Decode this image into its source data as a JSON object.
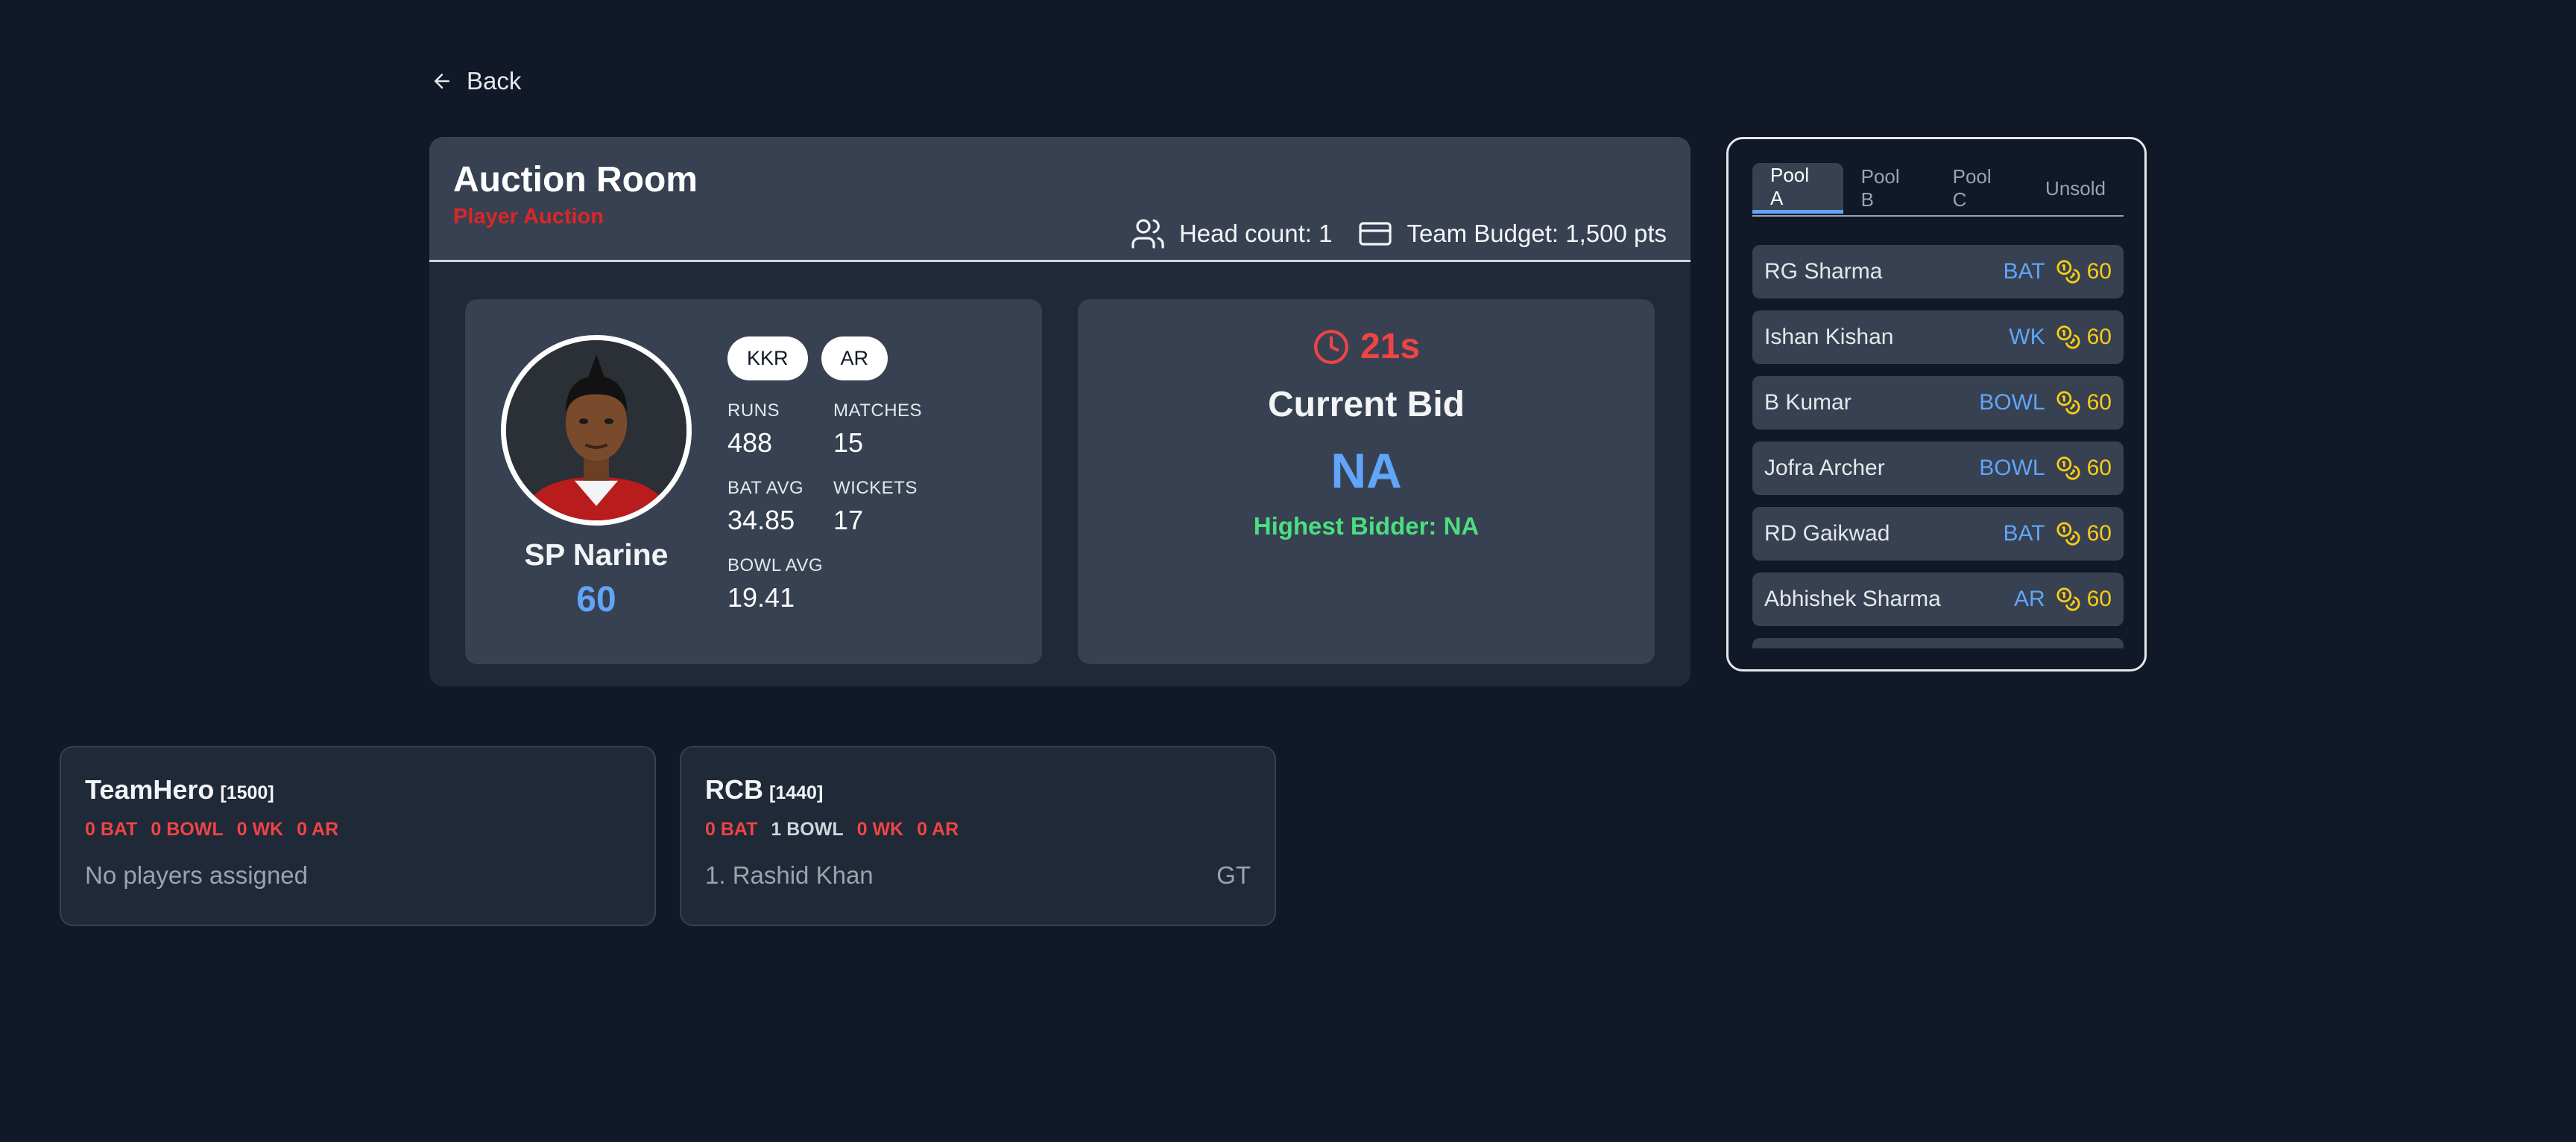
{
  "nav": {
    "back_label": "Back"
  },
  "room": {
    "title": "Auction Room",
    "subtitle": "Player Auction",
    "head_count": "Head count: 1",
    "team_budget": "Team Budget: 1,500 pts"
  },
  "player": {
    "name": "SP Narine",
    "price": "60",
    "badges": [
      "KKR",
      "AR"
    ],
    "stats": [
      {
        "label": "RUNS",
        "value": "488"
      },
      {
        "label": "MATCHES",
        "value": "15"
      },
      {
        "label": "BAT AVG",
        "value": "34.85"
      },
      {
        "label": "WICKETS",
        "value": "17"
      },
      {
        "label": "BOWL AVG",
        "value": "19.41"
      }
    ]
  },
  "bid": {
    "timer": "21s",
    "title": "Current Bid",
    "value": "NA",
    "bidder": "Highest Bidder: NA"
  },
  "pools": {
    "tabs": [
      "Pool A",
      "Pool B",
      "Pool C",
      "Unsold"
    ],
    "active_tab": "Pool A",
    "players": [
      {
        "name": "RG Sharma",
        "role": "BAT",
        "cost": "60"
      },
      {
        "name": "Ishan Kishan",
        "role": "WK",
        "cost": "60"
      },
      {
        "name": "B Kumar",
        "role": "BOWL",
        "cost": "60"
      },
      {
        "name": "Jofra Archer",
        "role": "BOWL",
        "cost": "60"
      },
      {
        "name": "RD Gaikwad",
        "role": "BAT",
        "cost": "60"
      },
      {
        "name": "Abhishek Sharma",
        "role": "AR",
        "cost": "60"
      }
    ]
  },
  "teams": [
    {
      "name": "TeamHero",
      "budget": "[1500]",
      "counts": [
        "0 BAT",
        "0 BOWL",
        "0 WK",
        "0 AR"
      ],
      "empty_text": "No players assigned",
      "players": []
    },
    {
      "name": "RCB",
      "budget": "[1440]",
      "counts": [
        "0 BAT",
        "1 BOWL",
        "0 WK",
        "0 AR"
      ],
      "empty_text": "",
      "players": [
        {
          "label": "1. Rashid Khan",
          "team": "GT"
        }
      ]
    }
  ],
  "colors": {
    "background": "#111827",
    "panel": "#1f2937",
    "card": "#374151",
    "accent_blue": "#60a5fa",
    "alert_red": "#ef4444",
    "success_green": "#4ade80",
    "coin_yellow": "#facc15"
  }
}
